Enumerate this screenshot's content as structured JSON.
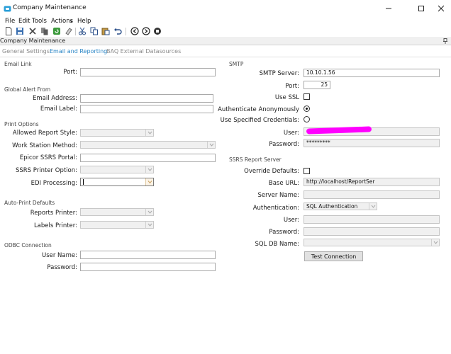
{
  "window": {
    "title": "Company Maintenance"
  },
  "menu": {
    "items": [
      "File",
      "Edit",
      "Tools",
      "Actions",
      "Help"
    ]
  },
  "toolbar": {
    "icons": [
      "new-icon",
      "save-icon",
      "delete-icon",
      "copy-icon",
      "refresh-icon",
      "clear-icon",
      "cut-icon",
      "copy-icon",
      "paste-icon",
      "undo-icon",
      "back-icon",
      "forward-icon",
      "stop-icon"
    ]
  },
  "header": {
    "title": "Company Maintenance"
  },
  "tabs": [
    {
      "label": "General Settings",
      "active": false
    },
    {
      "label": "Email and Reporting",
      "active": true
    },
    {
      "label": "BAQ External Datasources",
      "active": false
    }
  ],
  "email_link": {
    "section": "Email Link",
    "port_label": "Port:",
    "port_value": ""
  },
  "global_alert": {
    "section": "Global Alert From",
    "address_label": "Email Address:",
    "address_value": "",
    "email_label_label": "Email Label:",
    "email_label_value": ""
  },
  "print_options": {
    "section": "Print Options",
    "allowed_report_style_label": "Allowed Report Style:",
    "work_station_method_label": "Work Station Method:",
    "epicor_ssrs_portal_label": "Epicor SSRS Portal:",
    "ssrs_printer_option_label": "SSRS Printer Option:",
    "edi_processing_label": "EDI Processing:"
  },
  "auto_print": {
    "section": "Auto-Print Defaults",
    "reports_printer_label": "Reports Printer:",
    "labels_printer_label": "Labels Printer:"
  },
  "odbc": {
    "section": "ODBC Connection",
    "user_name_label": "User Name:",
    "user_name_value": "",
    "password_label": "Password:",
    "password_value": ""
  },
  "smtp": {
    "section": "SMTP",
    "server_label": "SMTP Server:",
    "server_value": "10.10.1.56",
    "port_label": "Port:",
    "port_value": "25",
    "use_ssl_label": "Use SSL",
    "auth_anon_label": "Authenticate Anonymously",
    "use_creds_label": "Use Specified Credentials:",
    "user_label": "User:",
    "user_value": "",
    "password_label": "Password:",
    "password_value": "*********"
  },
  "ssrs": {
    "section": "SSRS Report Server",
    "override_label": "Override Defaults:",
    "base_url_label": "Base URL:",
    "base_url_value": "http://localhost/ReportSer",
    "server_name_label": "Server Name:",
    "server_name_value": "",
    "authentication_label": "Authentication:",
    "authentication_value": "SQL Authentication",
    "user_label": "User:",
    "user_value": "",
    "password_label": "Password:",
    "password_value": "",
    "db_name_label": "SQL DB Name:",
    "db_name_value": "",
    "test_button": "Test Connection"
  },
  "colors": {
    "accent": "#2b86c6",
    "redaction": "#ff00ff",
    "app_icon": "#2b9fd8"
  }
}
